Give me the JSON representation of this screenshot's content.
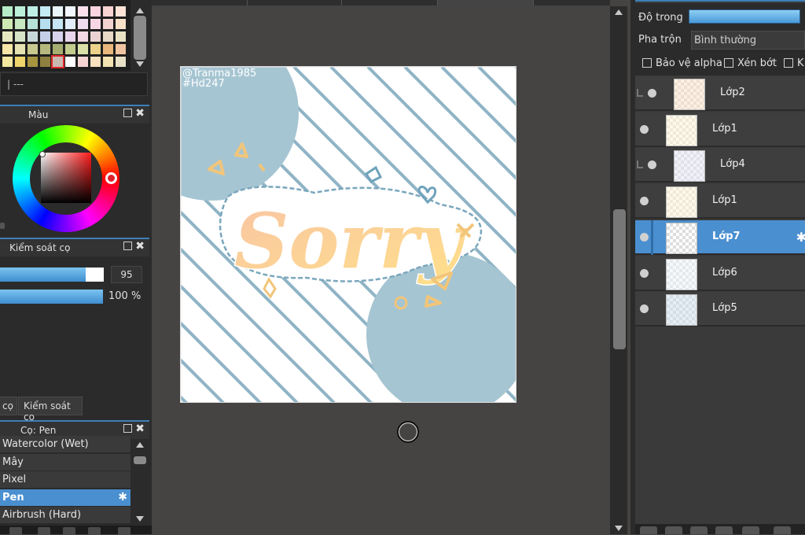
{
  "palette": {
    "colors": [
      [
        "#b7ecc9",
        "#bdf0d8",
        "#bfeee6",
        "#c3ecf3",
        "#e9f7fb",
        "#f2f7ff",
        "#fde2ee",
        "#fbd3df",
        "#f9d2d2",
        "#fde4d6"
      ],
      [
        "#cfe9b4",
        "#c6e8c0",
        "#b7e2d8",
        "#b5dfef",
        "#c7e6f5",
        "#e3ecfb",
        "#f0dcf0",
        "#f6d5e5",
        "#f3d3d0",
        "#f8e1c8"
      ],
      [
        "#e7e9c0",
        "#d6e3c7",
        "#c7d7d9",
        "#c5d0e8",
        "#d7d3ec",
        "#e8d6ec",
        "#f1d8e4",
        "#ecd2d2",
        "#e7d9c6",
        "#e9e2c4"
      ],
      [
        "#f7e7a8",
        "#e6e2b2",
        "#c9c88f",
        "#b6b97e",
        "#a6ad70",
        "#c2cc8c",
        "#dbe0a8",
        "#ecd18a",
        "#e9b77b",
        "#f1c4a1"
      ],
      [
        "#f4e8a0",
        "#efd56b",
        "#a89540",
        "#8e8140",
        "#c9b8b0",
        "#ffffff",
        "#f6d4d4",
        "#f8e0c0",
        "#f3e2b2",
        "#e7e1c7"
      ]
    ],
    "selected_index": [
      4,
      4
    ],
    "hex_value": "| ---"
  },
  "color_panel": {
    "title": "Màu",
    "hue": "#e0202a"
  },
  "brush_control": {
    "title": "Kiểm soát cọ",
    "size_value": "95",
    "size_fraction": 0.95,
    "opacity_value": "100 %",
    "opacity_fraction": 1.0
  },
  "bottom_tabs": {
    "tab1": "cọ",
    "tab2": "Kiểm soát cọ"
  },
  "brush_panel": {
    "title": "Cọ: Pen",
    "items": [
      "Watercolor (Wet)",
      "Mây",
      "Pixel",
      "Pen",
      "Airbrush (Hard)"
    ],
    "selected": "Pen"
  },
  "artwork": {
    "credit_line1": "@Tranma1985",
    "credit_line2": "#Hd247",
    "lettering": "Sorry",
    "accent_blue": "#a6c5d2",
    "stripe_color": "#8fb4c6",
    "letter_gradient": [
      "#f9c5a3",
      "#ffe08a"
    ]
  },
  "layer_props": {
    "opacity_label": "Độ trong",
    "blend_label": "Pha trộn",
    "blend_value": "Bình thường",
    "protect_alpha": "Bảo vệ alpha",
    "clipping": "Xén bớt",
    "lock_partial": "K"
  },
  "layers": [
    {
      "name": "Lớp2",
      "selected": false,
      "folder": true
    },
    {
      "name": "Lớp1",
      "selected": false,
      "folder": false
    },
    {
      "name": "Lớp4",
      "selected": false,
      "folder": true
    },
    {
      "name": "Lớp1",
      "selected": false,
      "folder": false
    },
    {
      "name": "Lớp7",
      "selected": true,
      "folder": false
    },
    {
      "name": "Lớp6",
      "selected": false,
      "folder": false
    },
    {
      "name": "Lớp5",
      "selected": false,
      "folder": false
    }
  ]
}
